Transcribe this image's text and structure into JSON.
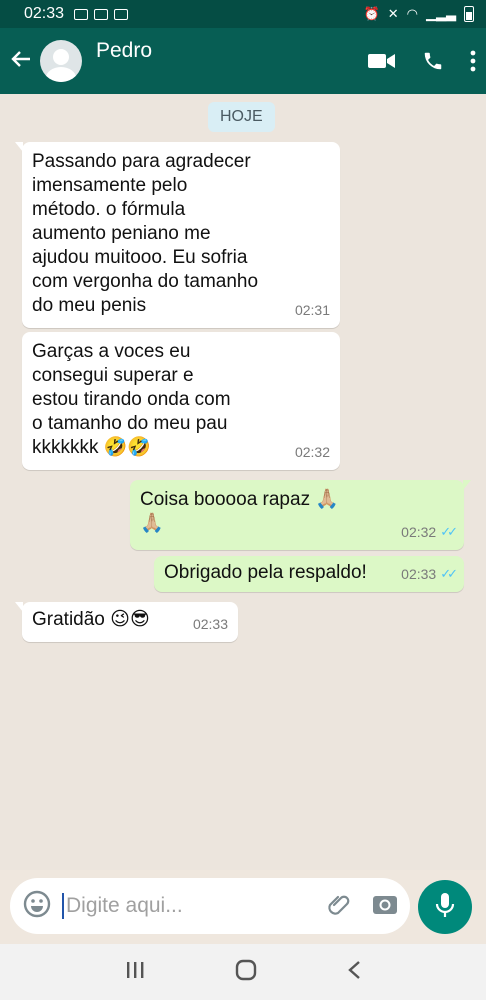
{
  "status": {
    "time": "02:33"
  },
  "header": {
    "contact_name": "Pedro"
  },
  "chat": {
    "date_chip": "HOJE",
    "messages": [
      {
        "direction": "in",
        "text": "Passando para agradecer\nimensamente pelo\nmétodo. o fórmula\naumento peniano me\najudou muitooo. Eu sofria\ncom vergonha do tamanho\ndo meu penis",
        "time": "02:31"
      },
      {
        "direction": "in",
        "text": "Garças a voces eu\nconsegui superar e\nestou tirando onda com\no tamanho do meu pau\nkkkkkkk 🤣🤣",
        "time": "02:32"
      },
      {
        "direction": "out",
        "text": "Coisa booooa rapaz 🙏🏼\n🙏🏼",
        "time": "02:32"
      },
      {
        "direction": "out",
        "text": "Obrigado pela respaldo!",
        "time": "02:33"
      },
      {
        "direction": "in",
        "text": "Gratidão 😉😎",
        "time": "02:33"
      }
    ]
  },
  "composer": {
    "placeholder": "Digite aqui..."
  }
}
